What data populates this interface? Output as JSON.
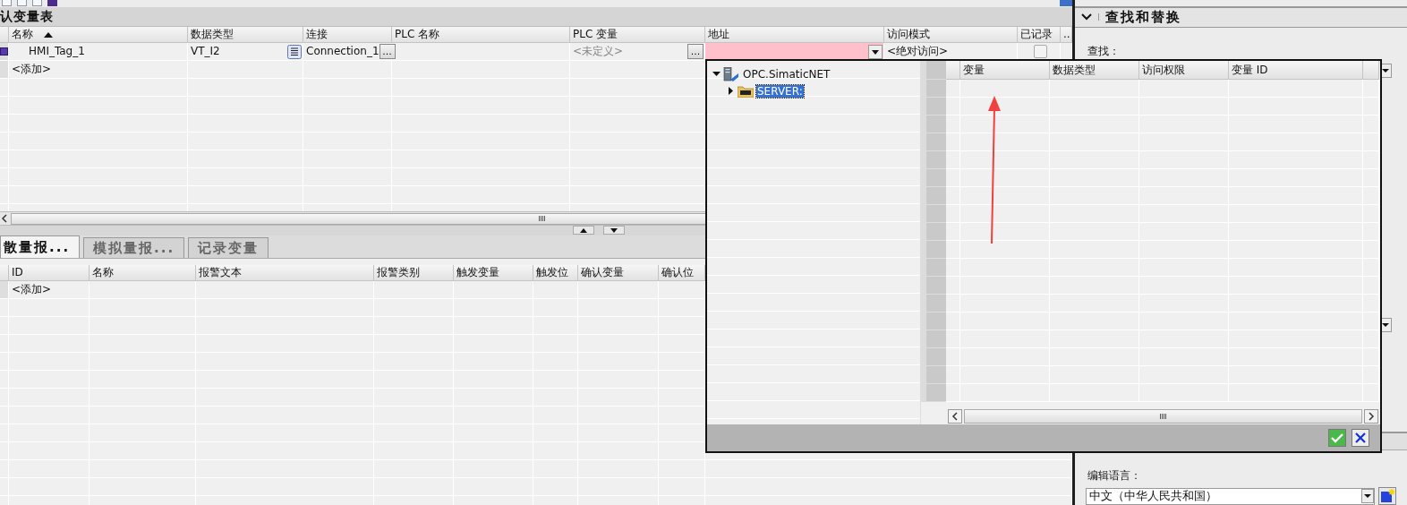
{
  "tag_table": {
    "title": "认变量表",
    "columns": [
      {
        "label": "名称",
        "sort_ascending": true
      },
      {
        "label": "数据类型"
      },
      {
        "label": "连接"
      },
      {
        "label": "PLC 名称"
      },
      {
        "label": "PLC 变量"
      },
      {
        "label": "地址"
      },
      {
        "label": "访问模式"
      },
      {
        "label": "已记录"
      },
      {
        "label": "..."
      }
    ],
    "rows": [
      {
        "name": "HMI_Tag_1",
        "data_type": "VT_I2",
        "connection": "Connection_1",
        "connection_button": "...",
        "plc_tag": "<未定义>",
        "plc_tag_button": "...",
        "address": {
          "invalid": true,
          "expanded": true
        },
        "access_mode": "<绝对访问>",
        "logged": false
      }
    ],
    "add_row": "<添加>"
  },
  "alarm_tabs": [
    {
      "label": "散量报...",
      "selected": true
    },
    {
      "label": "模拟量报...",
      "selected": false
    },
    {
      "label": "记录变量",
      "selected": false
    }
  ],
  "alarm_table": {
    "columns": [
      "ID",
      "名称",
      "报警文本",
      "报警类别",
      "触发变量",
      "触发位",
      "确认变量",
      "确认位"
    ],
    "add_row": "<添加>"
  },
  "address_browser": {
    "tree": [
      {
        "label": "OPC.SimaticNET",
        "expanded": true,
        "selected": false,
        "children": [
          {
            "label": "SERVER:",
            "expanded": false,
            "selected": true
          }
        ]
      }
    ],
    "columns": [
      "变量",
      "数据类型",
      "访问权限",
      "变量 ID"
    ]
  },
  "find_replace": {
    "title": "查找和替换",
    "expanded": true,
    "find_label": "查找：",
    "language_label": "编辑语言：",
    "language": "中文（中华人民共和国）"
  }
}
